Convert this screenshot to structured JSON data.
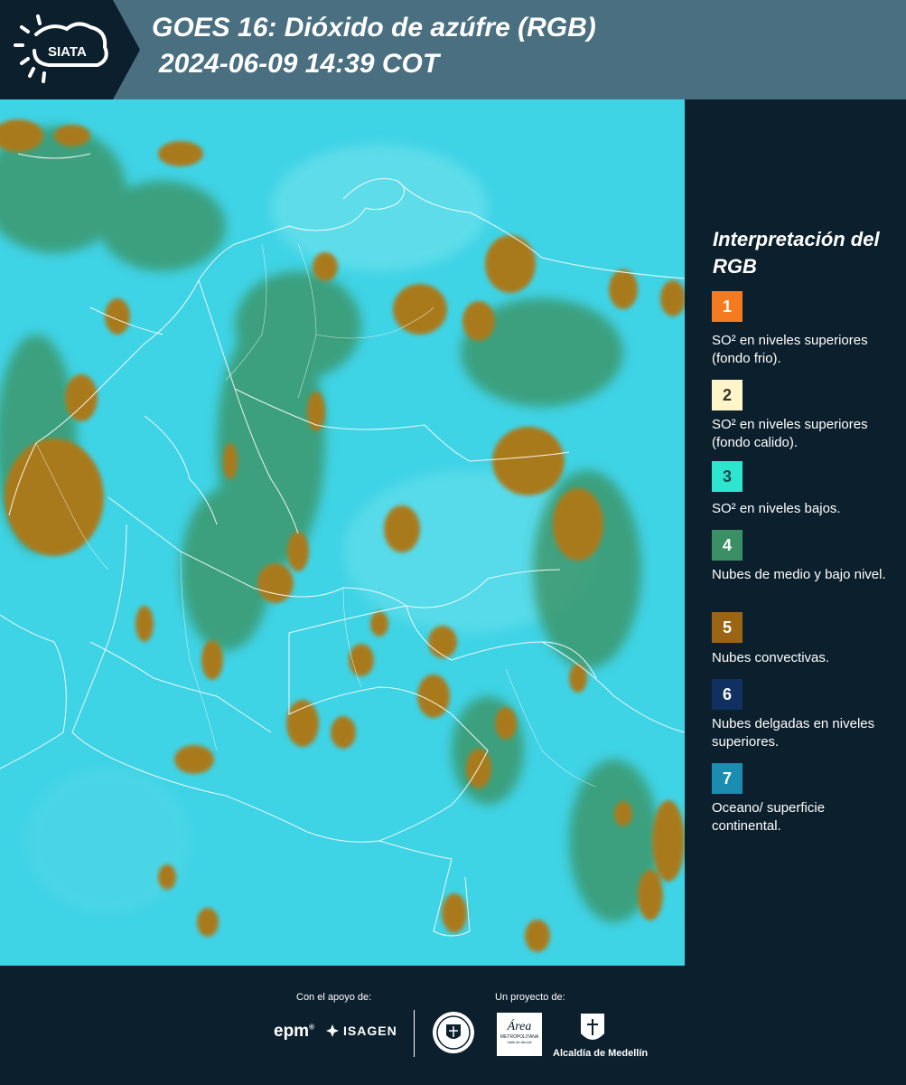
{
  "header": {
    "logo_text": "SIATA",
    "title_line1": "GOES 16: Dióxido de azúfre (RGB)",
    "title_line2": "2024-06-09 14:39 COT"
  },
  "colors": {
    "header_bg": "#4a6f80",
    "panel_bg": "#0b1f2c",
    "map_background": "#3fd3e6",
    "cloud_convective": "#a97a1f",
    "cloud_mid_low": "#3b8f5c"
  },
  "legend": {
    "title": "Interpretación del RGB",
    "items": [
      {
        "num": "1",
        "color": "#f47b20",
        "text": "SO² en niveles superiores (fondo frio)."
      },
      {
        "num": "2",
        "color": "#fff5c8",
        "text": "SO² en niveles superiores (fondo calido)."
      },
      {
        "num": "3",
        "color": "#2ee6d0",
        "text": "SO² en niveles bajos."
      },
      {
        "num": "4",
        "color": "#3b8f65",
        "text": "Nubes de medio y bajo nivel."
      },
      {
        "num": "5",
        "color": "#9a6514",
        "text": "Nubes convectivas."
      },
      {
        "num": "6",
        "color": "#0f3060",
        "text": "Nubes delgadas en niveles superiores."
      },
      {
        "num": "7",
        "color": "#1a8db0",
        "text": "Oceano/ superficie continental."
      }
    ]
  },
  "footer": {
    "support_label": "Con el apoyo de:",
    "project_label": "Un proyecto de:",
    "sponsor_epm": "epm",
    "sponsor_isagen": "ISAGEN",
    "partner_area_text": "Área",
    "partner_area_sub": "METROPOLITANA",
    "partner_area_sub2": "Valle de Aburrá",
    "partner_alcaldia": "Alcaldía de Medellín"
  }
}
